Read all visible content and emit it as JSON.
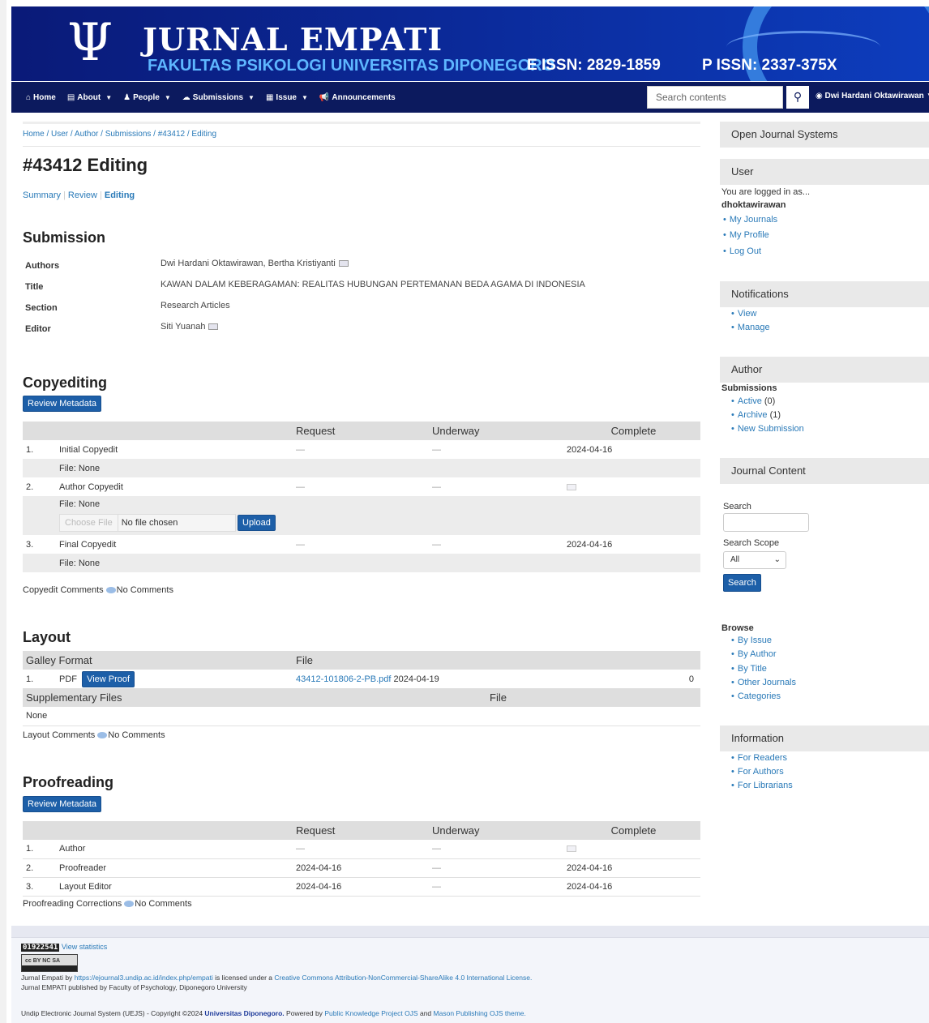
{
  "header": {
    "logo_glyph": "Ψ",
    "title": "JURNAL EMPATI",
    "subtitle": "FAKULTAS PSIKOLOGI UNIVERSITAS DIPONEGORO",
    "eissn": "E ISSN: 2829-1859",
    "pissn": "P ISSN: 2337-375X"
  },
  "nav": {
    "items": [
      {
        "label": "Home",
        "icon": "home-icon",
        "dropdown": false
      },
      {
        "label": "About",
        "icon": "book-icon",
        "dropdown": true
      },
      {
        "label": "People",
        "icon": "person-icon",
        "dropdown": true
      },
      {
        "label": "Submissions",
        "icon": "cloud-upload-icon",
        "dropdown": true
      },
      {
        "label": "Issue",
        "icon": "document-icon",
        "dropdown": true
      },
      {
        "label": "Announcements",
        "icon": "megaphone-icon",
        "dropdown": false
      }
    ],
    "search_placeholder": "Search contents",
    "user_name": "Dwi Hardani Oktawirawan"
  },
  "breadcrumb": "Home / User / Author / Submissions / #43412 / Editing",
  "page_title": "#43412 Editing",
  "subnav": {
    "summary": "Summary",
    "review": "Review",
    "editing": "Editing"
  },
  "submission": {
    "heading": "Submission",
    "authors_label": "Authors",
    "authors": "Dwi Hardani Oktawirawan, Bertha Kristiyanti",
    "title_label": "Title",
    "title": "KAWAN DALAM KEBERAGAMAN: REALITAS HUBUNGAN PERTEMANAN BEDA AGAMA DI INDONESIA",
    "section_label": "Section",
    "section": "Research Articles",
    "editor_label": "Editor",
    "editor": "Siti Yuanah"
  },
  "copyediting": {
    "heading": "Copyediting",
    "review_metadata": "Review Metadata",
    "col_request": "Request",
    "col_underway": "Underway",
    "col_complete": "Complete",
    "rows": [
      {
        "num": "1.",
        "name": "Initial Copyedit",
        "request": "—",
        "underway": "—",
        "complete": "2024-04-16",
        "file": "File: None"
      },
      {
        "num": "2.",
        "name": "Author Copyedit",
        "request": "—",
        "underway": "—",
        "complete": "",
        "file": "File: None"
      },
      {
        "num": "3.",
        "name": "Final Copyedit",
        "request": "—",
        "underway": "—",
        "complete": "2024-04-16",
        "file": "File: None"
      }
    ],
    "choose_file": "Choose File",
    "no_file": "No file chosen",
    "upload": "Upload",
    "comments_label": "Copyedit Comments",
    "comments_value": "No Comments"
  },
  "layout": {
    "heading": "Layout",
    "col_galley": "Galley Format",
    "col_file": "File",
    "galley_num": "1.",
    "galley_format": "PDF",
    "view_proof": "View Proof",
    "galley_file": "43412-101806-2-PB.pdf",
    "galley_date": "2024-04-19",
    "galley_count": "0",
    "supp_label": "Supplementary Files",
    "supp_file_col": "File",
    "supp_value": "None",
    "comments_label": "Layout Comments",
    "comments_value": "No Comments"
  },
  "proofreading": {
    "heading": "Proofreading",
    "review_metadata": "Review Metadata",
    "col_request": "Request",
    "col_underway": "Underway",
    "col_complete": "Complete",
    "rows": [
      {
        "num": "1.",
        "name": "Author",
        "request": "—",
        "underway": "—",
        "complete": ""
      },
      {
        "num": "2.",
        "name": "Proofreader",
        "request": "2024-04-16",
        "underway": "—",
        "complete": "2024-04-16"
      },
      {
        "num": "3.",
        "name": "Layout Editor",
        "request": "2024-04-16",
        "underway": "—",
        "complete": "2024-04-16"
      }
    ],
    "comments_label": "Proofreading Corrections",
    "comments_value": "No Comments"
  },
  "sidebar": {
    "ojs": "Open Journal Systems",
    "user_title": "User",
    "logged_in_as": "You are logged in as...",
    "username": "dhoktawirawan",
    "user_links": [
      "My Journals",
      "My Profile",
      "Log Out"
    ],
    "notifications_title": "Notifications",
    "notification_links": [
      "View",
      "Manage"
    ],
    "author_title": "Author",
    "submissions_label": "Submissions",
    "active": "Active",
    "active_count": "(0)",
    "archive": "Archive",
    "archive_count": "(1)",
    "new_submission": "New Submission",
    "journal_content_title": "Journal Content",
    "search_label": "Search",
    "search_scope_label": "Search Scope",
    "scope_value": "All",
    "search_button": "Search",
    "browse_label": "Browse",
    "browse_links": [
      "By Issue",
      "By Author",
      "By Title",
      "Other Journals",
      "Categories"
    ],
    "information_title": "Information",
    "information_links": [
      "For Readers",
      "For Authors",
      "For Librarians"
    ]
  },
  "footer": {
    "counter": "01922541",
    "view_statistics": "View statistics",
    "cc_label": "cc BY NC SA",
    "license_prefix": "Jurnal Empati by",
    "license_url": "https://ejournal3.undip.ac.id/index.php/empati",
    "license_mid": "is licensed under a",
    "license_name": "Creative Commons Attribution-NonCommercial-ShareAlike 4.0 International License.",
    "published_by": "Jurnal EMPATI published by Faculty of Psychology, Diponegoro University",
    "copyright_prefix": "Undip Electronic Journal System (UEJS) - Copyright ©2024",
    "university": "Universitas Diponegoro.",
    "powered_by": "Powered by",
    "pkp": "Public Knowledge Project OJS",
    "and": "and",
    "theme": "Mason Publishing OJS theme."
  },
  "colors": {
    "banner": "#0b2a9a",
    "nav": "#0c1a5e",
    "link": "#2a7ab8",
    "button": "#1d5fa8"
  }
}
